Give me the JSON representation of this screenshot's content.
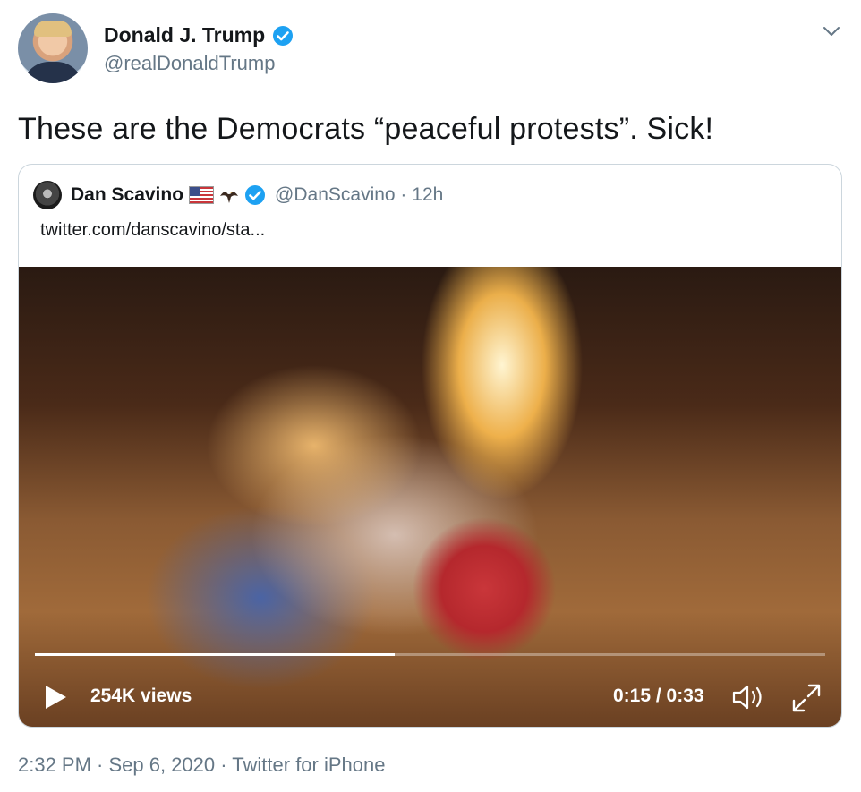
{
  "tweet": {
    "author_name": "Donald J. Trump",
    "author_handle": "@realDonaldTrump",
    "verified_icon": "verified-badge-icon",
    "text": "These are the Democrats “peaceful protests”. Sick!",
    "meta": "2:32 PM · Sep 6, 2020 · Twitter for iPhone"
  },
  "quote": {
    "author_name": "Dan Scavino",
    "emoji": [
      "us-flag-icon",
      "eagle-icon"
    ],
    "handle_time": "@DanScavino · 12h",
    "link": "twitter.com/danscavino/sta..."
  },
  "video": {
    "views": "254K views",
    "time": "0:15 / 0:33",
    "progress": 0.455
  },
  "colors": {
    "verified_blue": "#1da1f2",
    "secondary_text": "#657786",
    "card_border": "#ccd6dd"
  }
}
